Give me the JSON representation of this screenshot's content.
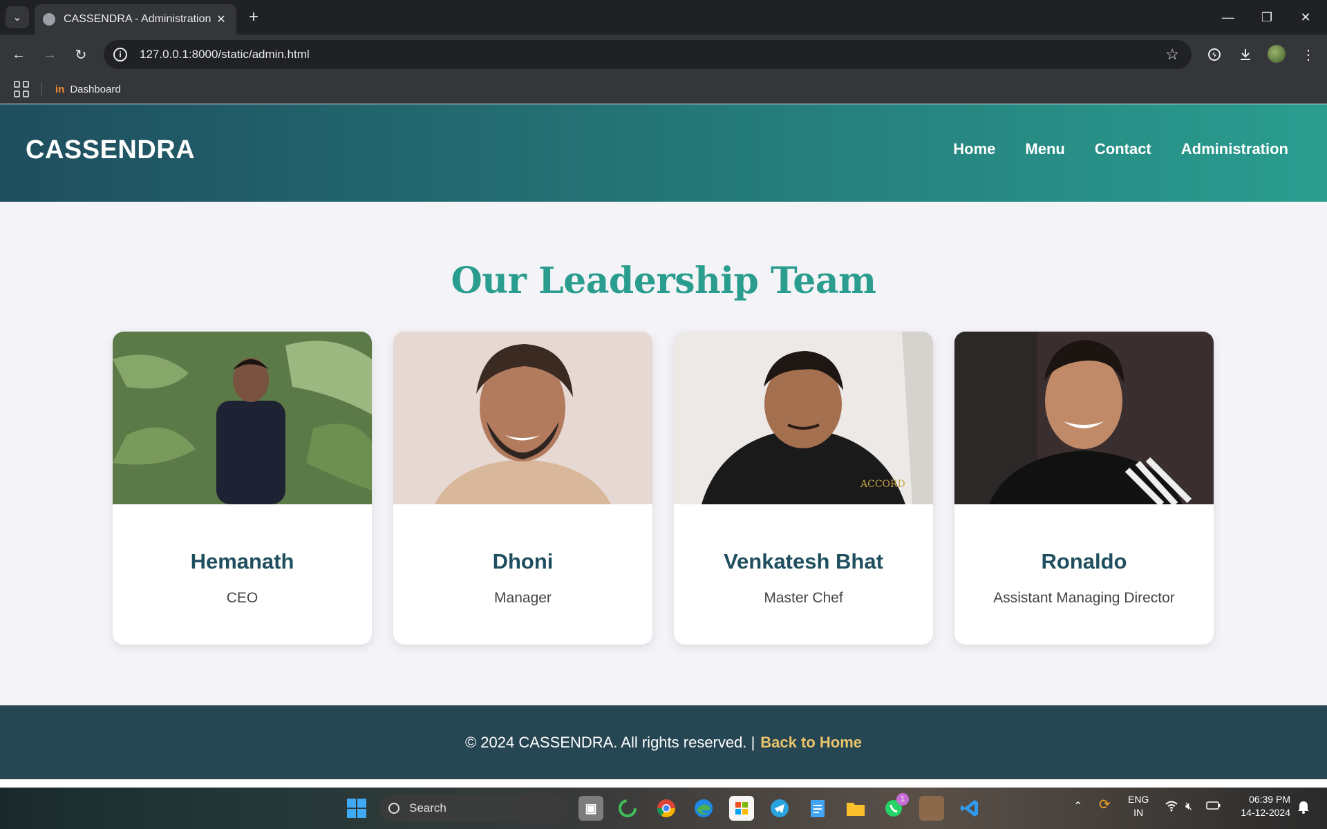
{
  "browser": {
    "tab_title": "CASSENDRA - Administration",
    "tab_close": "✕",
    "new_tab": "+",
    "url": "127.0.0.1:8000/static/admin.html",
    "bookmark": "Dashboard",
    "bookmark_logo": "in",
    "window_controls": [
      "—",
      "❐",
      "✕"
    ],
    "nav_back": "←",
    "nav_forward": "→",
    "reload": "↻",
    "star": "☆",
    "menu": "⋮",
    "tab_menu": "⌄"
  },
  "site": {
    "brand": "CASSENDRA",
    "nav": [
      "Home",
      "Menu",
      "Contact",
      "Administration"
    ],
    "section_title": "Our Leadership Team",
    "team": [
      {
        "name": "Hemanath",
        "role": "CEO"
      },
      {
        "name": "Dhoni",
        "role": "Manager"
      },
      {
        "name": "Venkatesh Bhat",
        "role": "Master Chef"
      },
      {
        "name": "Ronaldo",
        "role": "Assistant Managing Director"
      }
    ],
    "footer_text": "© 2024 CASSENDRA. All rights reserved. |",
    "footer_link": "Back to Home"
  },
  "taskbar": {
    "search_placeholder": "Search",
    "whatsapp_badge": "1",
    "lang_1": "ENG",
    "lang_2": "IN",
    "time": "06:39 PM",
    "date": "14-12-2024"
  },
  "colors": {
    "accent": "#2a9d8f",
    "header_start": "#1f4e5f",
    "footer_bg": "#264653",
    "footer_link": "#e9c46a"
  }
}
